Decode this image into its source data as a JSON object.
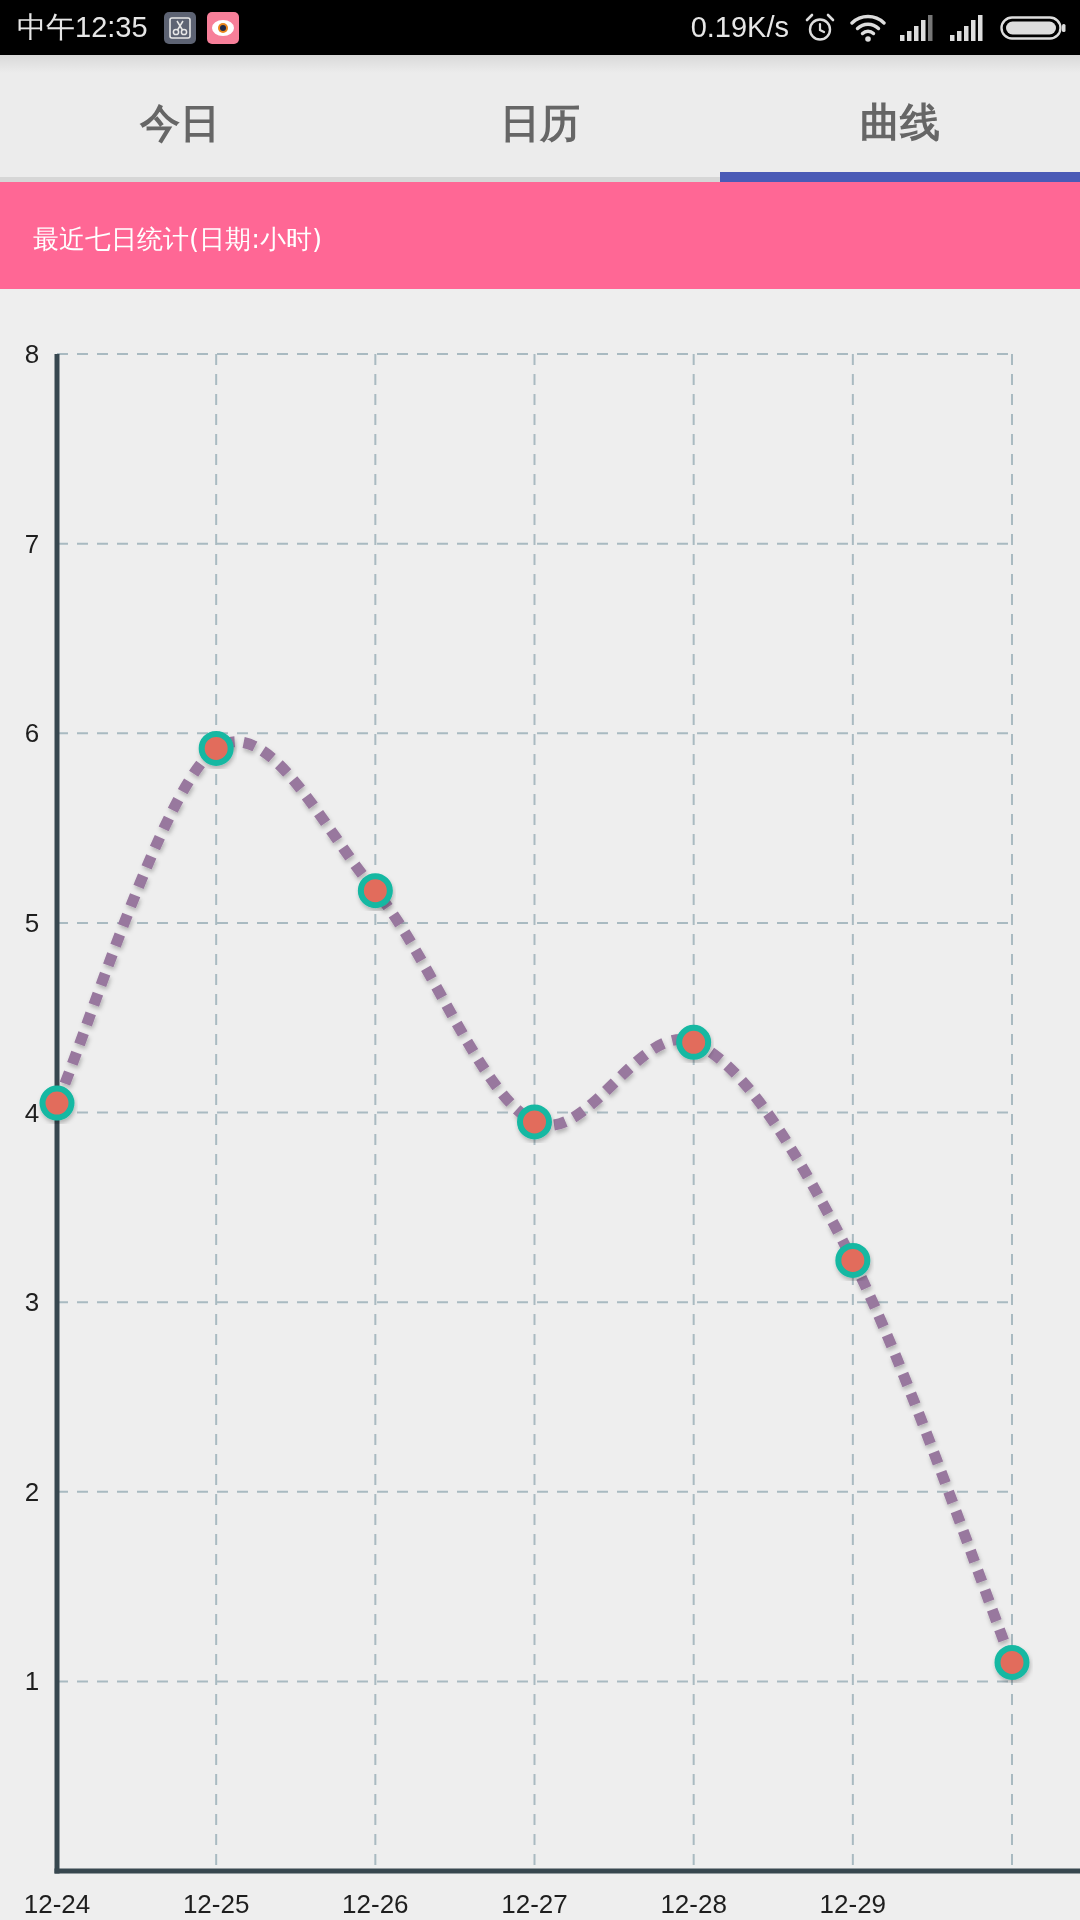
{
  "status_bar": {
    "time": "中午12:35",
    "network_speed": "0.19K/s"
  },
  "tabs": [
    {
      "label": "今日",
      "selected": false
    },
    {
      "label": "日历",
      "selected": false
    },
    {
      "label": "曲线",
      "selected": true
    }
  ],
  "header": {
    "title": "最近七日统计(日期:小时)"
  },
  "chart": {
    "chart_data": {
      "type": "line",
      "categories": [
        "12-24",
        "12-25",
        "12-26",
        "12-27",
        "12-28",
        "12-29",
        null
      ],
      "ylim": [
        0,
        8
      ],
      "yticks": [
        1,
        2,
        3,
        4,
        5,
        6,
        7,
        8
      ],
      "grid": true,
      "line_style": "dashed",
      "marker": "circle",
      "values": [
        4.05,
        5.92,
        5.17,
        3.95,
        4.37,
        3.22,
        1.1
      ]
    }
  }
}
